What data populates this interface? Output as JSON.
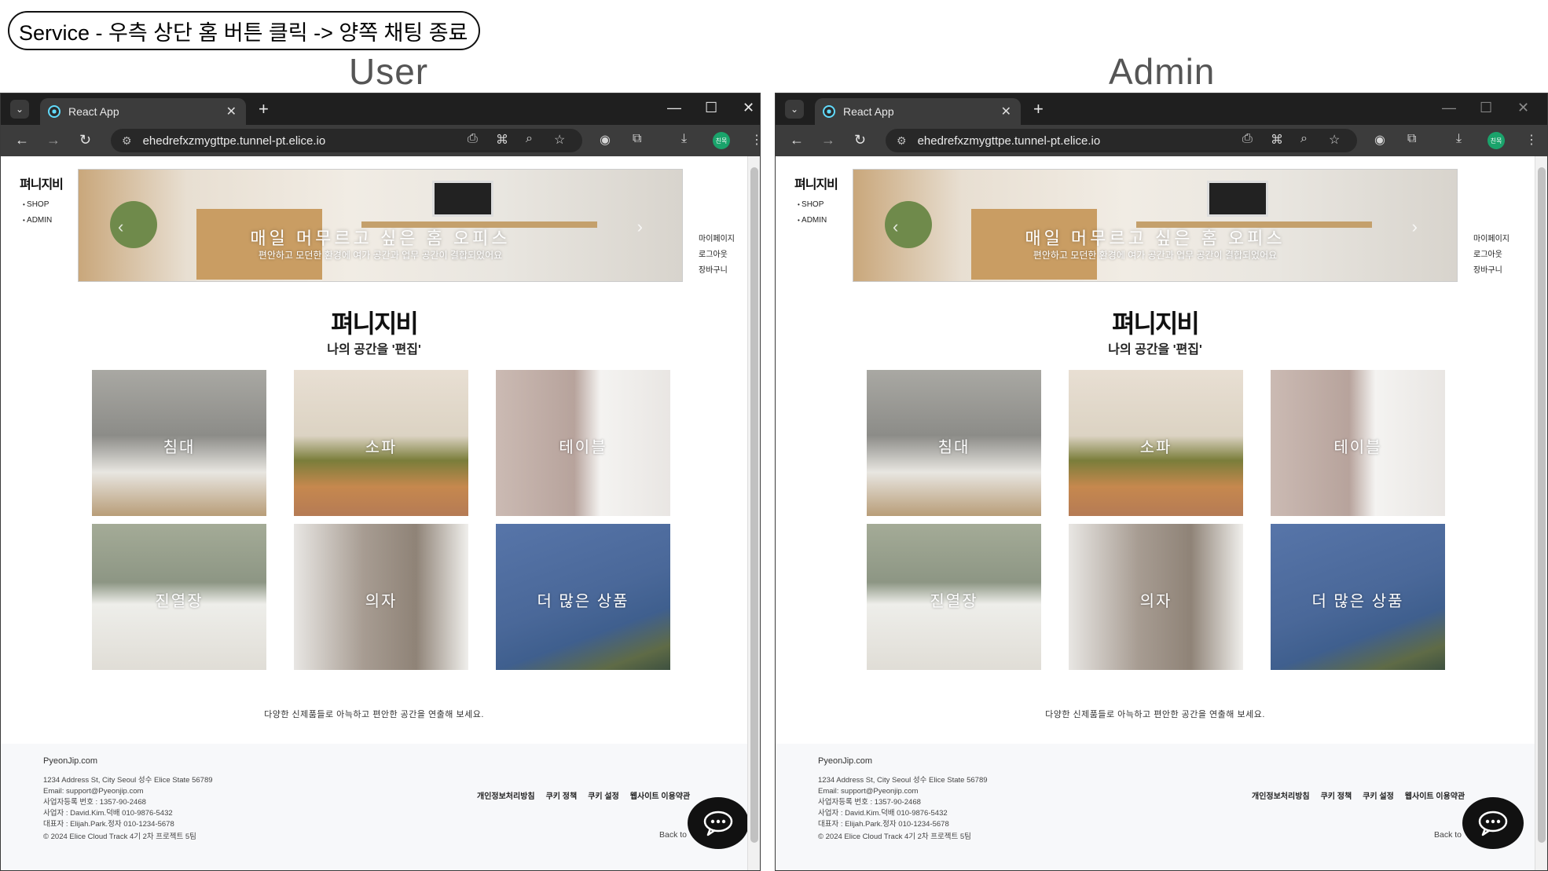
{
  "caption": "Service - 우측 상단 홈 버튼 클릭 -> 양쪽 채팅 종료",
  "panes": [
    {
      "label": "User"
    },
    {
      "label": "Admin"
    }
  ],
  "browser": {
    "tab_title": "React App",
    "url": "ehedrefxzmygttpe.tunnel-pt.elice.io",
    "profile_badge": "친목"
  },
  "site": {
    "brand": "펴니지비",
    "nav": [
      "SHOP",
      "ADMIN"
    ],
    "hero_title": "매일 머무르고 싶은 홈 오피스",
    "hero_subtitle": "편안하고 모던한 환경에 여가 공간과 업무 공간이 결합되었어요",
    "account_links": [
      "마이페이지",
      "로그아웃",
      "장바구니"
    ],
    "tagline": "나의 공간을 '편집'",
    "categories": [
      "침대",
      "소파",
      "테이블",
      "진열장",
      "의자",
      "더 많은 상품"
    ],
    "description": "다양한 신제품들로 아늑하고 편안한 공간을 연출해 보세요.",
    "footer": {
      "site": "PyeonJip.com",
      "address": "1234 Address St, City Seoul 성수 Elice State 56789",
      "email": "Email: support@Pyeonjip.com",
      "biz_no": "사업자등록 번호 : 1357-90-2468",
      "rep1": "사업자 : David.Kim.덕배 010-9876-5432",
      "rep2": "대표자 : Elijah.Park.정자 010-1234-5678",
      "copyright": "© 2024 Elice Cloud Track 4기 2차 프로젝트 5팀",
      "links": [
        "개인정보처리방침",
        "쿠키 정책",
        "쿠키 설정",
        "웹사이트 이용약관"
      ],
      "back_to_top": "Back to"
    }
  }
}
